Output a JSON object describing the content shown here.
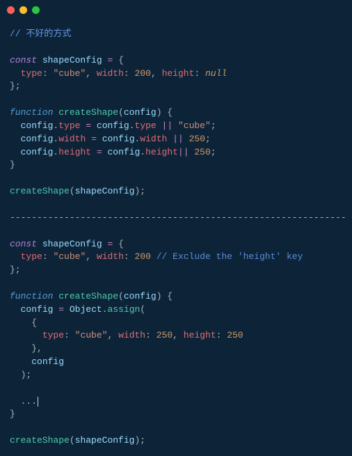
{
  "titlebar": {
    "buttons": [
      "close",
      "minimize",
      "maximize"
    ]
  },
  "code": {
    "comment1": "// 不好的方式",
    "block1": {
      "const": "const",
      "shapeConfig": "shapeConfig",
      "eq": "=",
      "lbrace": "{",
      "type_key": "type",
      "type_val": "\"cube\"",
      "width_key": "width",
      "width_val": "200",
      "height_key": "height",
      "height_val": "null",
      "rbrace": "};"
    },
    "func1": {
      "function": "function",
      "name": "createShape",
      "param": "config",
      "l1_lhs_obj": "config",
      "l1_lhs_prop": "type",
      "l1_rhs_obj": "config",
      "l1_rhs_prop": "type",
      "l1_or": "||",
      "l1_default": "\"cube\"",
      "l2_lhs_prop": "width",
      "l2_rhs_prop": "width",
      "l2_default": "250",
      "l3_lhs_prop": "height",
      "l3_rhs_prop": "height",
      "l3_default": "250"
    },
    "call1": {
      "fn": "createShape",
      "arg": "shapeConfig"
    },
    "divider": "--------------------------------------------------------------",
    "block2": {
      "const": "const",
      "shapeConfig": "shapeConfig",
      "type_key": "type",
      "type_val": "\"cube\"",
      "width_key": "width",
      "width_val": "200",
      "comment": "// Exclude the 'height' key"
    },
    "func2": {
      "function": "function",
      "name": "createShape",
      "param": "config",
      "assign_lhs": "config",
      "object": "Object",
      "assign_method": "assign",
      "inner_type_key": "type",
      "inner_type_val": "\"cube\"",
      "inner_width_key": "width",
      "inner_width_val": "250",
      "inner_height_key": "height",
      "inner_height_val": "250",
      "inner_arg": "config",
      "ellipsis": "..."
    },
    "call2": {
      "fn": "createShape",
      "arg": "shapeConfig"
    }
  }
}
